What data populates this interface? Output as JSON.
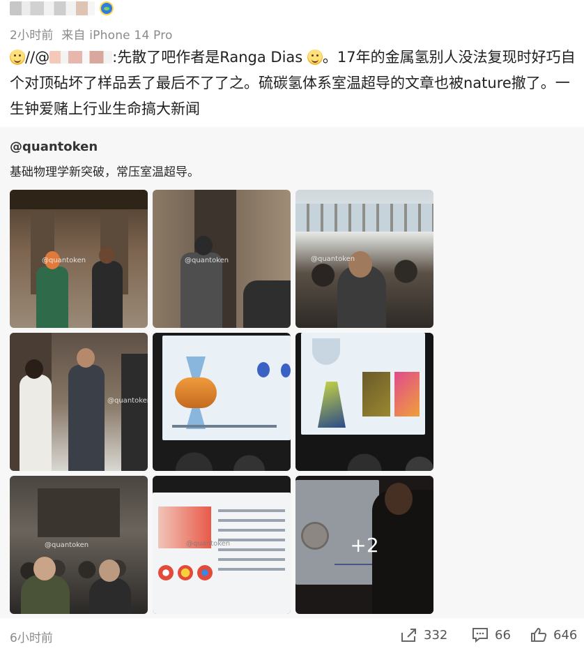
{
  "post": {
    "time": "2小时前",
    "source": "来自 iPhone 14 Pro",
    "text_prefix": "//@",
    "text_main": ":先散了吧作者是Ranga Dias",
    "text_rest": "。17年的金属氢别人没法复现时好巧自个对顶砧坏了样品丢了最后不了了之。硫碳氢体系室温超导的文章也被nature撤了。一生钟爱赌上行业生命搞大新闻"
  },
  "repost": {
    "user": "@quantoken",
    "text": "基础物理学新突破，常压室温超导。",
    "watermark": "@quantoken",
    "more_count": "+2"
  },
  "footer": {
    "time": "6小时前",
    "share_count": "332",
    "comment_count": "66",
    "like_count": "646"
  },
  "icons": {
    "badge": "verified-badge-icon",
    "share": "share-icon",
    "comment": "comment-icon",
    "like": "like-icon"
  },
  "colors": {
    "meta_gray": "#8a8a8a",
    "repost_bg": "#f7f7f7",
    "text": "#1f1f1f"
  }
}
